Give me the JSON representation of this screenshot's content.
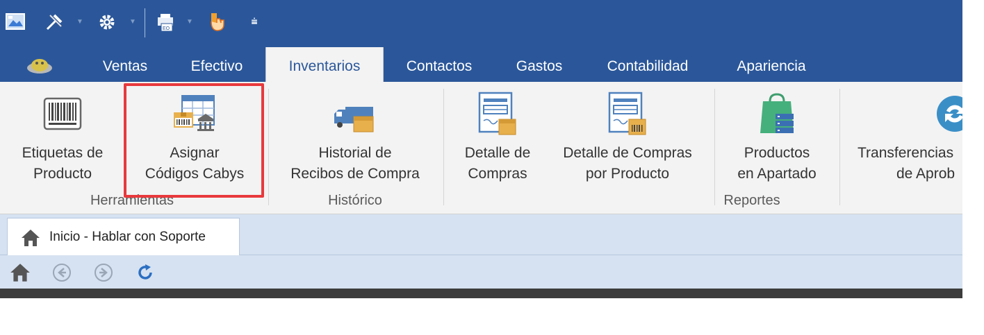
{
  "quick_access": {
    "icons": [
      "app-icon",
      "tools-icon",
      "settings-icon",
      "print-icon",
      "touch-icon"
    ],
    "customize_glyph": "⩧"
  },
  "tabs": [
    {
      "label": ""
    },
    {
      "label": "Ventas"
    },
    {
      "label": "Efectivo"
    },
    {
      "label": "Inventarios"
    },
    {
      "label": "Contactos"
    },
    {
      "label": "Gastos"
    },
    {
      "label": "Contabilidad"
    },
    {
      "label": "Apariencia"
    }
  ],
  "active_tab": "Inventarios",
  "ribbon": {
    "groups": [
      {
        "label": "Herramientas"
      },
      {
        "label": "Histórico"
      },
      {
        "label": "Reportes"
      }
    ],
    "buttons": [
      {
        "line1": "Etiquetas de",
        "line2": "Producto"
      },
      {
        "line1": "Asignar",
        "line2": "Códigos Cabys"
      },
      {
        "line1": "Historial de",
        "line2": "Recibos de Compra"
      },
      {
        "line1": "Detalle de",
        "line2": "Compras"
      },
      {
        "line1": "Detalle de Compras",
        "line2": "por Producto"
      },
      {
        "line1": "Productos",
        "line2": "en Apartado"
      },
      {
        "line1": "Transferencias",
        "line2": "de Aprob"
      }
    ]
  },
  "document_tab": {
    "label": "Inicio - Hablar con Soporte"
  },
  "nav": {
    "icons": [
      "home-icon",
      "back-icon",
      "forward-icon",
      "refresh-icon"
    ]
  },
  "colors": {
    "accent": "#2b579a",
    "highlight": "#e8393c",
    "nav_bg": "#d6e2f1"
  }
}
